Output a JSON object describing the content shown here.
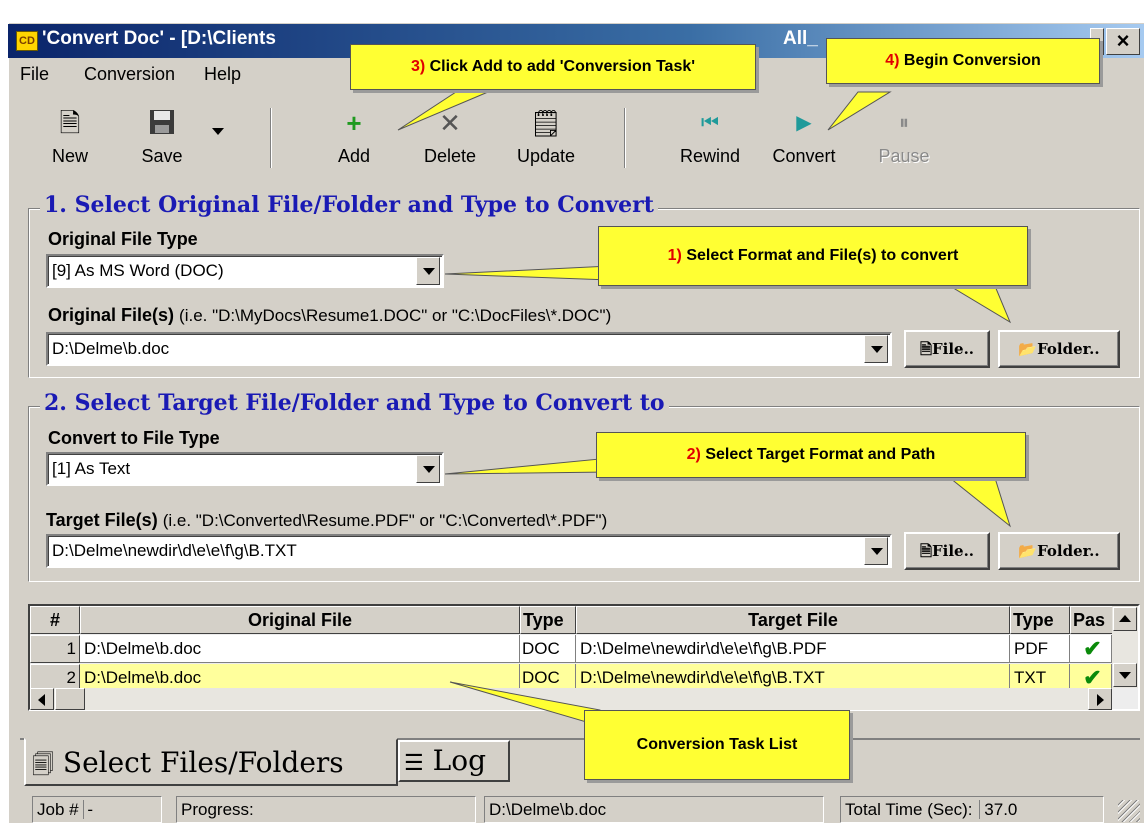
{
  "window": {
    "title": "'Convert Doc' - [D:\\Clients",
    "title_tail": "All_",
    "app_icon": "cd-app-icon",
    "close_label": "×"
  },
  "menu": {
    "items": [
      "File",
      "Conversion",
      "Help"
    ]
  },
  "toolbar": {
    "new_label": "New",
    "save_label": "Save",
    "add_label": "Add",
    "delete_label": "Delete",
    "update_label": "Update",
    "rewind_label": "Rewind",
    "convert_label": "Convert",
    "pause_label": "Pause",
    "icons": {
      "new": "new-doc-icon",
      "save": "floppy-disk-icon",
      "add": "plus-icon",
      "delete": "x-icon",
      "update": "update-doc-icon",
      "rewind": "rewind-icon",
      "convert": "play-icon",
      "pause": "pause-icon"
    }
  },
  "section1": {
    "title": "1. Select Original File/Folder and Type to Convert",
    "type_label": "Original File Type",
    "type_value": "[9] As MS Word (DOC)",
    "files_label": "Original File(s)",
    "files_hint": "(i.e. \"D:\\MyDocs\\Resume1.DOC\"  or \"C:\\DocFiles\\*.DOC\")",
    "files_value": "D:\\Delme\\b.doc",
    "file_button": "File..",
    "folder_button": "Folder.."
  },
  "section2": {
    "title": "2. Select Target File/Folder and Type to Convert to",
    "type_label": "Convert to File Type",
    "type_value": "[1] As Text",
    "files_label": "Target File(s)",
    "files_hint": "(i.e. \"D:\\Converted\\Resume.PDF\" or \"C:\\Converted\\*.PDF\")",
    "files_value": "D:\\Delme\\newdir\\d\\e\\e\\f\\g\\B.TXT",
    "file_button": "File..",
    "folder_button": "Folder.."
  },
  "grid": {
    "headers": [
      "#",
      "Original File",
      "Type",
      "Target File",
      "Type",
      "Pas"
    ],
    "rows": [
      {
        "num": "1",
        "original": "D:\\Delme\\b.doc",
        "otype": "DOC",
        "target": "D:\\Delme\\newdir\\d\\e\\e\\f\\g\\B.PDF",
        "ttype": "PDF",
        "pass": "✔"
      },
      {
        "num": "2",
        "original": "D:\\Delme\\b.doc",
        "otype": "DOC",
        "target": "D:\\Delme\\newdir\\d\\e\\e\\f\\g\\B.TXT",
        "ttype": "TXT",
        "pass": "✔"
      }
    ],
    "selected_row_color": "#ffff9c"
  },
  "tabs": {
    "files": "Select Files/Folders",
    "log": "Log"
  },
  "status": {
    "job_label": "Job #",
    "job_value": "-",
    "progress_label": "Progress:",
    "current_file": "D:\\Delme\\b.doc",
    "total_time_label": "Total Time (Sec):",
    "total_time_value": "37.0"
  },
  "callouts": {
    "c1_num": "1)",
    "c1_text": "Select Format and File(s) to convert",
    "c2_num": "2)",
    "c2_text": "Select Target Format and Path",
    "c3_num": "3)",
    "c3_text": "Click Add to add 'Conversion Task'",
    "c4_num": "4)",
    "c4_text": "Begin Conversion",
    "c5_text": "Conversion Task List"
  },
  "colors": {
    "accent_title": "#1a1ab4",
    "callout_bg": "#ffff33",
    "callout_num": "#e00000",
    "check": "#0a8a0a"
  }
}
